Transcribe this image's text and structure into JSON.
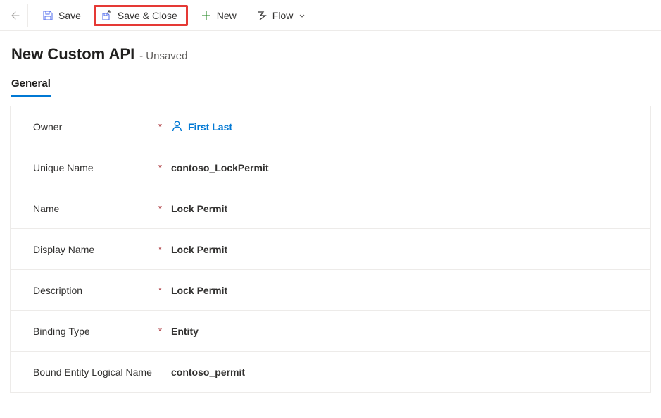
{
  "toolbar": {
    "save_label": "Save",
    "save_close_label": "Save & Close",
    "new_label": "New",
    "flow_label": "Flow"
  },
  "header": {
    "title": "New Custom API",
    "subtitle": "- Unsaved"
  },
  "tabs": {
    "general": "General"
  },
  "form": {
    "owner": {
      "label": "Owner",
      "value": "First Last",
      "required": "*"
    },
    "unique_name": {
      "label": "Unique Name",
      "value": "contoso_LockPermit",
      "required": "*"
    },
    "name": {
      "label": "Name",
      "value": "Lock Permit",
      "required": "*"
    },
    "display_name": {
      "label": "Display Name",
      "value": "Lock Permit",
      "required": "*"
    },
    "description": {
      "label": "Description",
      "value": "Lock Permit",
      "required": "*"
    },
    "binding_type": {
      "label": "Binding Type",
      "value": "Entity",
      "required": "*"
    },
    "bound_entity": {
      "label": "Bound Entity Logical Name",
      "value": "contoso_permit",
      "required": ""
    }
  }
}
